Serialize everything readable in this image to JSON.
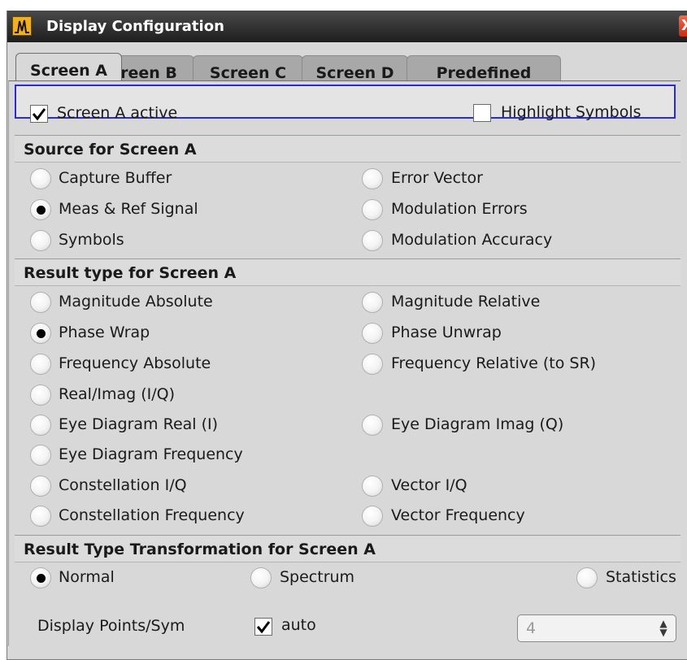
{
  "window": {
    "title": "Display Configuration",
    "close_glyph": "X",
    "icon": "spectrum-icon"
  },
  "tabs": [
    "Screen A",
    "Screen B",
    "Screen C",
    "Screen D",
    "Predefined"
  ],
  "active_tab": "Screen A",
  "active_row": {
    "screen_active": {
      "label": "Screen A active",
      "checked": true
    },
    "highlight_symbols": {
      "label": "Highlight Symbols",
      "checked": false
    }
  },
  "source": {
    "header": "Source for Screen A",
    "options": [
      "Capture Buffer",
      "Error Vector",
      "Meas & Ref Signal",
      "Modulation Errors",
      "Symbols",
      "Modulation Accuracy"
    ],
    "selected": "Meas & Ref Signal"
  },
  "result_type": {
    "header": "Result type for Screen A",
    "options": [
      "Magnitude Absolute",
      "Magnitude Relative",
      "Phase Wrap",
      "Phase Unwrap",
      "Frequency Absolute",
      "Frequency Relative (to SR)",
      "Real/Imag (I/Q)",
      "Eye Diagram Real (I)",
      "Eye Diagram Imag (Q)",
      "Eye Diagram Frequency",
      "Constellation I/Q",
      "Vector I/Q",
      "Constellation Frequency",
      "Vector Frequency"
    ],
    "selected": "Phase Wrap"
  },
  "transformation": {
    "header": "Result Type Transformation for Screen A",
    "options": [
      "Normal",
      "Spectrum",
      "Statistics"
    ],
    "selected": "Normal"
  },
  "display_points": {
    "label": "Display Points/Sym",
    "auto_label": "auto",
    "auto_checked": true,
    "value": "4"
  },
  "colors": {
    "active_border": "#2b2bcf",
    "close_button": "#d9391c",
    "panel": "#d8d8d8"
  }
}
